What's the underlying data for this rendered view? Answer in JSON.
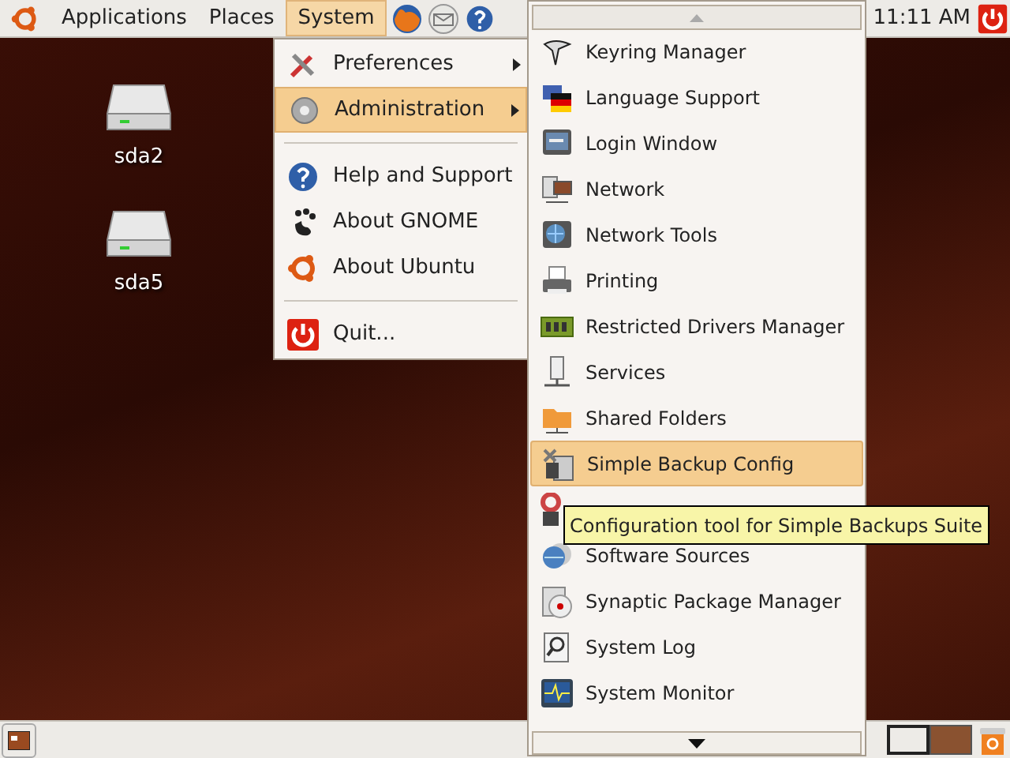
{
  "top_panel": {
    "menus": [
      {
        "label": "Applications",
        "selected": false
      },
      {
        "label": "Places",
        "selected": false
      },
      {
        "label": "System",
        "selected": true
      }
    ],
    "clock": "11:11 AM"
  },
  "desktop_icons": [
    {
      "label": "sda2"
    },
    {
      "label": "sda5"
    }
  ],
  "system_menu": {
    "items": [
      {
        "kind": "item",
        "label": "Preferences",
        "submenu": true,
        "selected": false
      },
      {
        "kind": "item",
        "label": "Administration",
        "submenu": true,
        "selected": true
      },
      {
        "kind": "separator"
      },
      {
        "kind": "item",
        "label": "Help and Support",
        "submenu": false,
        "selected": false
      },
      {
        "kind": "item",
        "label": "About GNOME",
        "submenu": false,
        "selected": false
      },
      {
        "kind": "item",
        "label": "About Ubuntu",
        "submenu": false,
        "selected": false
      },
      {
        "kind": "separator"
      },
      {
        "kind": "item",
        "label": "Quit...",
        "submenu": false,
        "selected": false
      }
    ]
  },
  "administration_menu": {
    "items": [
      {
        "kind": "item",
        "label": "Keyring Manager",
        "selected": false
      },
      {
        "kind": "item",
        "label": "Language Support",
        "selected": false
      },
      {
        "kind": "item",
        "label": "Login Window",
        "selected": false
      },
      {
        "kind": "item",
        "label": "Network",
        "selected": false
      },
      {
        "kind": "item",
        "label": "Network Tools",
        "selected": false
      },
      {
        "kind": "item",
        "label": "Printing",
        "selected": false
      },
      {
        "kind": "item",
        "label": "Restricted Drivers Manager",
        "selected": false
      },
      {
        "kind": "item",
        "label": "Services",
        "selected": false
      },
      {
        "kind": "item",
        "label": "Shared Folders",
        "selected": false
      },
      {
        "kind": "item",
        "label": "Simple Backup Config",
        "selected": true
      },
      {
        "kind": "covered",
        "selected": false
      },
      {
        "kind": "item",
        "label": "Software Sources",
        "selected": false
      },
      {
        "kind": "item",
        "label": "Synaptic Package Manager",
        "selected": false
      },
      {
        "kind": "item",
        "label": "System Log",
        "selected": false
      },
      {
        "kind": "item",
        "label": "System Monitor",
        "selected": false
      }
    ]
  },
  "tooltip": "Configuration tool for Simple Backups Suite",
  "bottom_panel": {
    "workspaces": [
      {
        "selected": true
      },
      {
        "selected": false
      }
    ]
  }
}
